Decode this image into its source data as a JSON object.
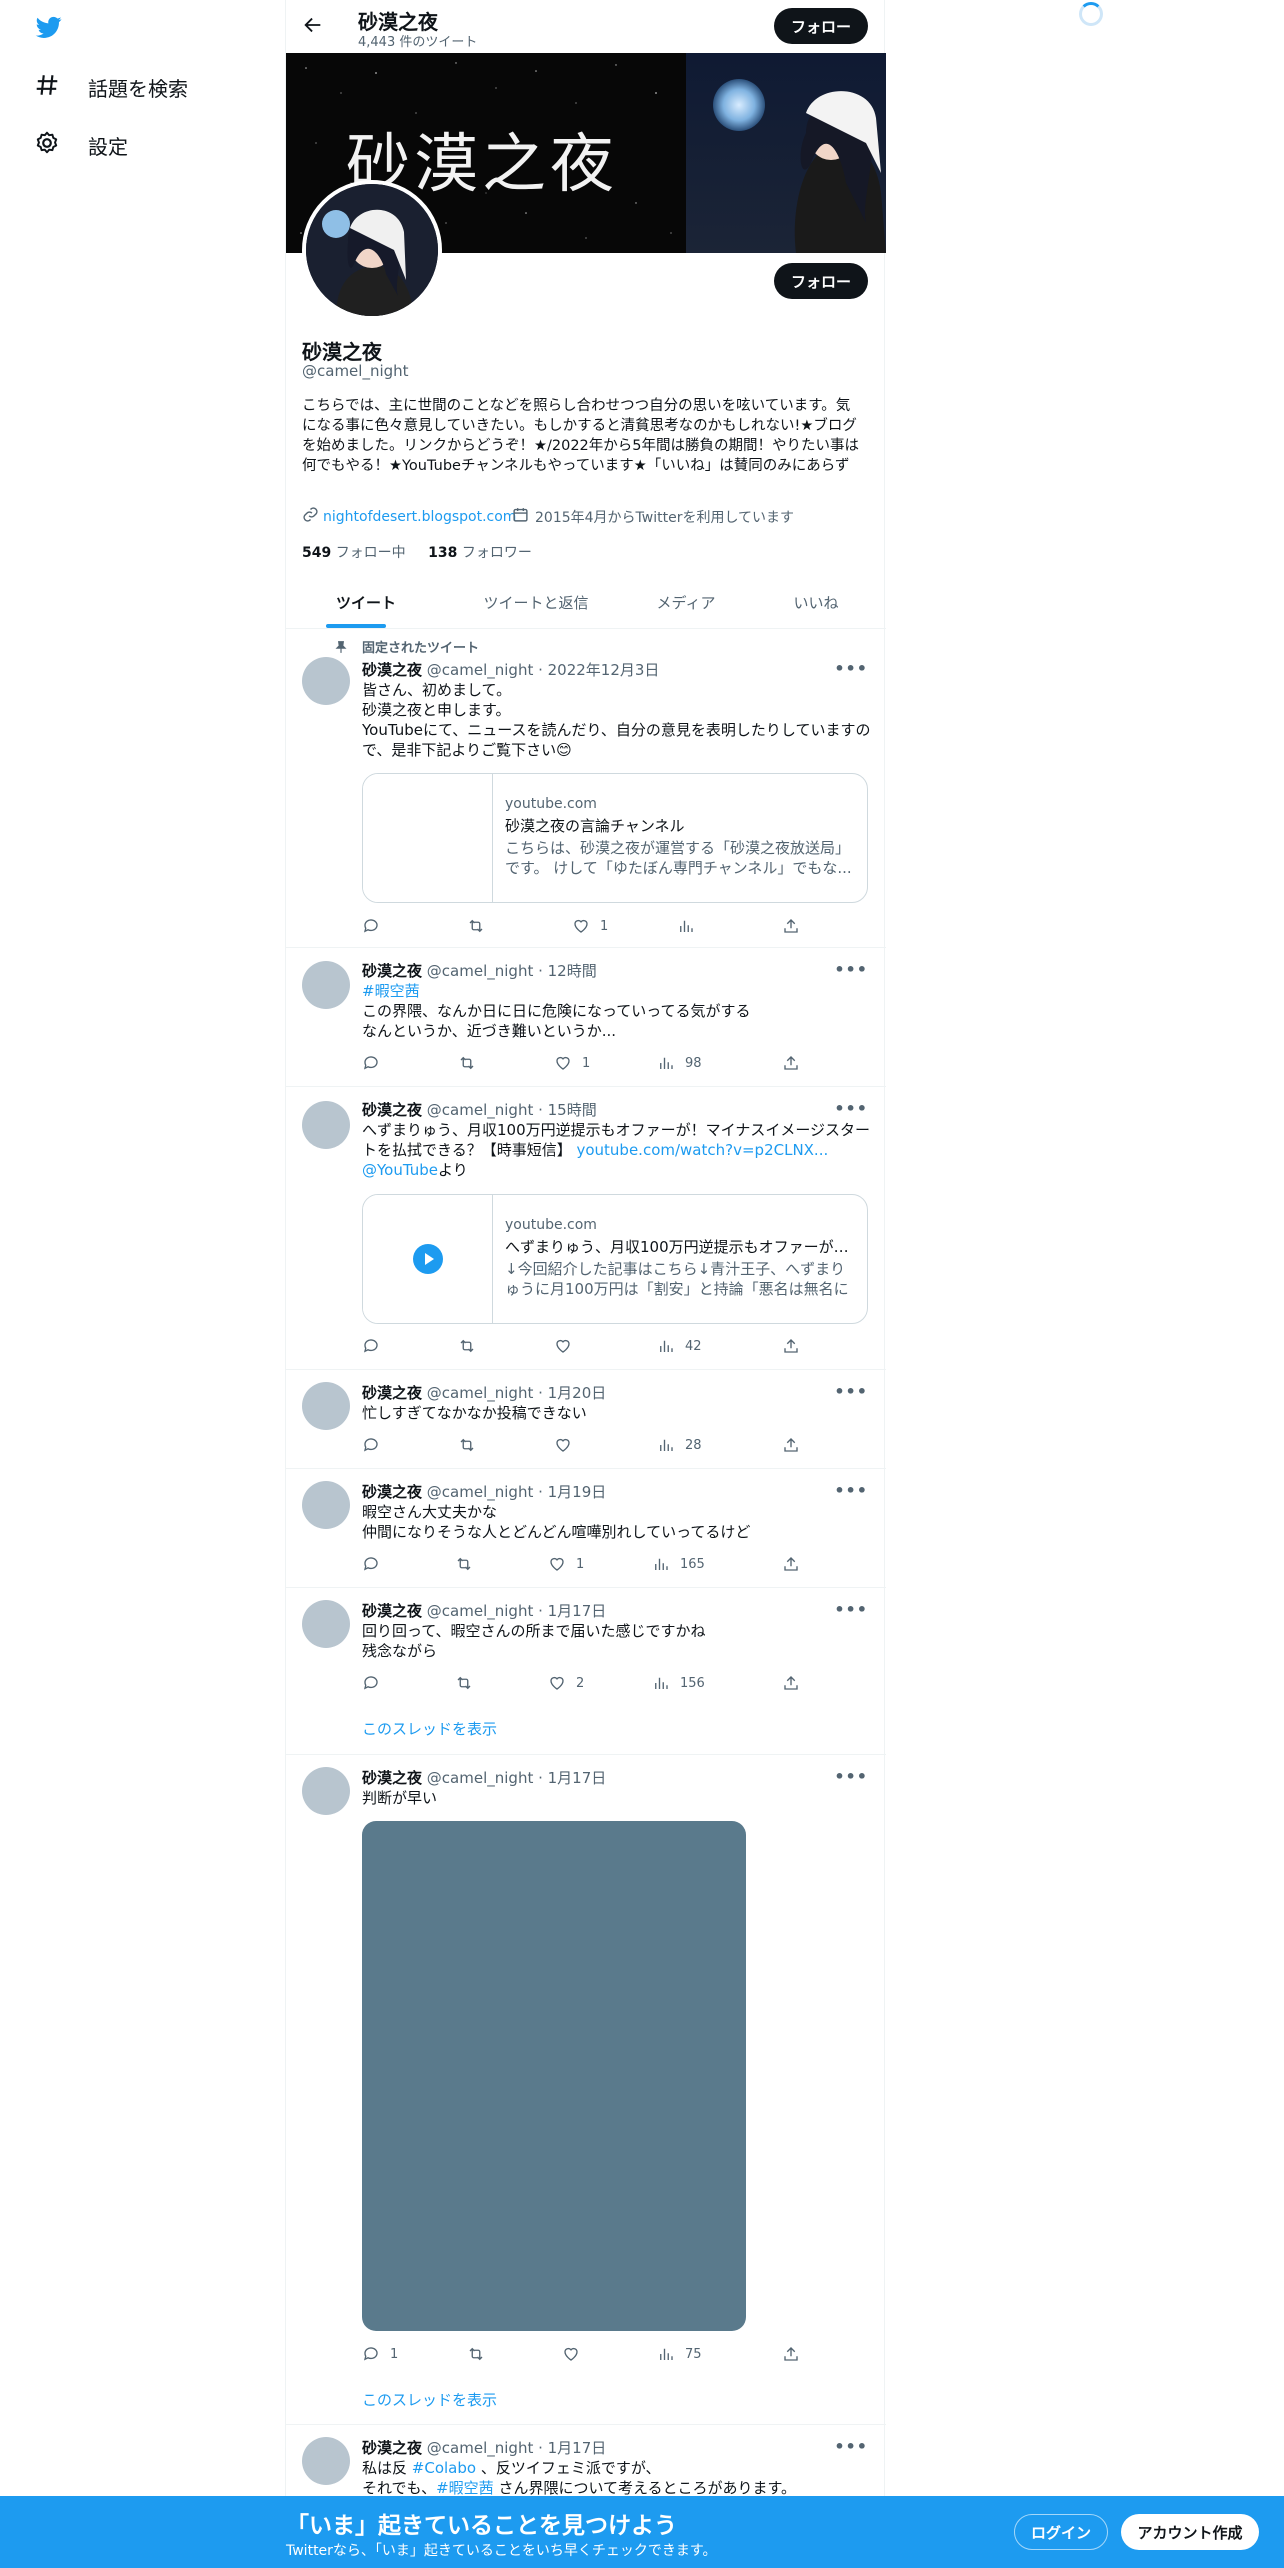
{
  "nav": {
    "explore_label": "話題を検索",
    "settings_label": "設定"
  },
  "header": {
    "title": "砂漠之夜",
    "tweet_count": "4,443 件のツイート",
    "follow_label": "フォロー"
  },
  "banner": {
    "text": "砂漠之夜"
  },
  "profile": {
    "name": "砂漠之夜",
    "handle": "@camel_night",
    "follow_label": "フォロー",
    "bio": "こちらでは、主に世間のことなどを照らし合わせつつ自分の思いを呟いています。気になる事に色々意見していきたい。もしかすると清貧思考なのかもしれない!★ブログを始めました。リンクからどうぞ！★/2022年から5年間は勝負の期間！やりたい事は何でもやる！★YouTubeチャンネルもやっています★「いいね」は賛同のみにあらず",
    "website": "nightofdesert.blogspot.com",
    "joined": "2015年4月からTwitterを利用しています",
    "following_count": "549",
    "following_label": "フォロー中",
    "followers_count": "138",
    "followers_label": "フォロワー"
  },
  "tabs": [
    "ツイート",
    "ツイートと返信",
    "メディア",
    "いいね"
  ],
  "tweets": [
    {
      "pinned_label": "固定されたツイート",
      "name": "砂漠之夜",
      "meta": "@camel_night · 2022年12月3日",
      "body": "皆さん、初めまして。\n砂漠之夜と申します。\nYouTubeにて、ニュースを読んだり、自分の意見を表明したりしていますので、是非下記よりご覧下さい😊",
      "card": {
        "domain": "youtube.com",
        "title": "砂漠之夜の言論チャンネル",
        "desc": "こちらは、砂漠之夜が運営する「砂漠之夜放送局」です。 けして「ゆたぼん専門チャンネル」でもな..."
      },
      "reply": "",
      "like": "1",
      "views": ""
    },
    {
      "name": "砂漠之夜",
      "meta": "@camel_night · 12時間",
      "hashtag": "#暇空茜",
      "body": "この界隈、なんか日に日に危険になっていってる気がする\nなんというか、近づき難いというか...",
      "reply": "",
      "like": "1",
      "views": "98"
    },
    {
      "name": "砂漠之夜",
      "meta": "@camel_night · 15時間",
      "body": "へずまりゅう、月収100万円逆提示もオファーが！マイナスイメージスタートを払拭できる？【時事短信】",
      "url": "youtube.com/watch?v=p2CLNX...",
      "mention": "@YouTube",
      "mention_suffix": "より",
      "card": {
        "domain": "youtube.com",
        "title": "へずまりゅう、月収100万円逆提示もオファーが！...",
        "desc": "↓今回紹介した記事はこちら↓青汁王子、へずまりゅうに月100万円は「割安」と持論「悪名は無名に勝..."
      },
      "reply": "",
      "like": "",
      "views": "42"
    },
    {
      "name": "砂漠之夜",
      "meta": "@camel_night · 1月20日",
      "body": "忙しすぎてなかなか投稿できない",
      "reply": "",
      "like": "",
      "views": "28"
    },
    {
      "name": "砂漠之夜",
      "meta": "@camel_night · 1月19日",
      "body": "暇空さん大丈夫かな\n仲間になりそうな人とどんどん喧嘩別れしていってるけど",
      "reply": "",
      "like": "1",
      "views": "165"
    },
    {
      "name": "砂漠之夜",
      "meta": "@camel_night · 1月17日",
      "body": "回り回って、暇空さんの所まで届いた感じですかね\n残念ながら",
      "reply": "",
      "like": "2",
      "views": "156",
      "thread_label": "このスレッドを表示"
    },
    {
      "name": "砂漠之夜",
      "meta": "@camel_night · 1月17日",
      "body": "判断が早い",
      "reply": "1",
      "like": "",
      "views": "75",
      "thread_label": "このスレッドを表示"
    },
    {
      "name": "砂漠之夜",
      "meta": "@camel_night · 1月17日",
      "body_prefix": "私は反 ",
      "tag1": "#Colabo",
      "body_mid": " 、反ツイフェミ派ですが、",
      "body_line2_prefix": "それでも、",
      "tag2": "#暇空茜",
      "body_line2_suffix": " さん界隈について考えるところがあります。"
    }
  ],
  "bottom_bar": {
    "headline": "「いま」起きていることを見つけよう",
    "sub": "Twitterなら、「いま」起きていることをいち早くチェックできます。",
    "login_label": "ログイン",
    "signup_label": "アカウント作成"
  },
  "colors": {
    "accent": "#1d9bf0",
    "text": "#0f1419",
    "muted": "#536471",
    "media_placeholder": "#5a7a8c"
  }
}
